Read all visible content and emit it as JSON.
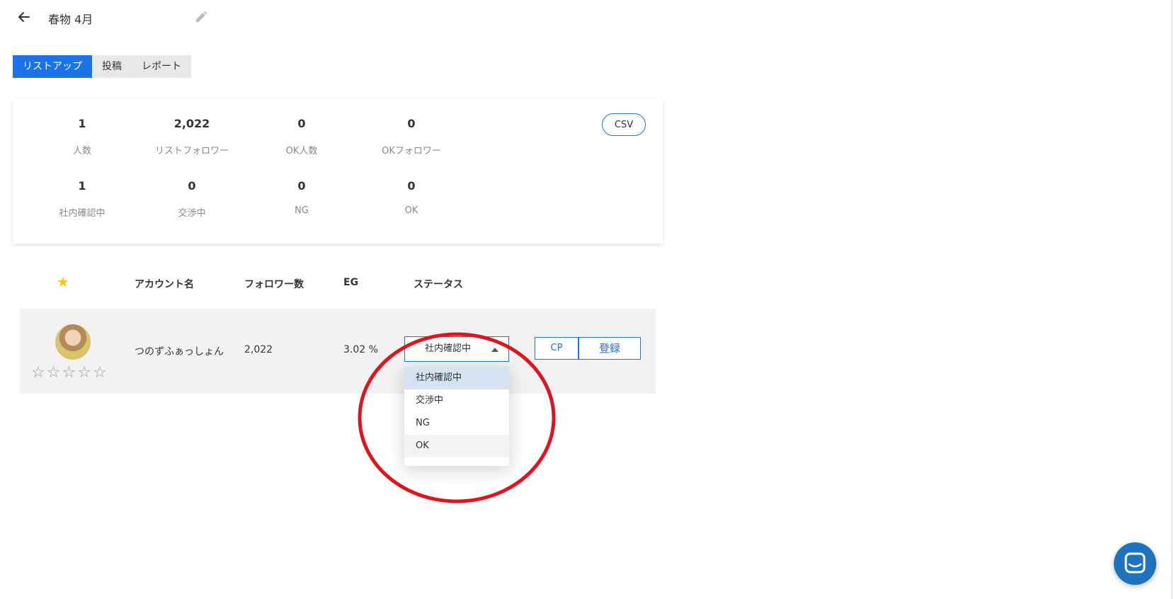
{
  "header": {
    "title": "春物 4月",
    "back_icon": "arrow-left-icon",
    "edit_icon": "pencil-icon"
  },
  "tabs": [
    {
      "label": "リストアップ",
      "active": true
    },
    {
      "label": "投稿",
      "active": false
    },
    {
      "label": "レポート",
      "active": false
    }
  ],
  "stats": {
    "csv_label": "CSV",
    "items": [
      {
        "value": "1",
        "label": "人数"
      },
      {
        "value": "2,022",
        "label": "リストフォロワー"
      },
      {
        "value": "0",
        "label": "OK人数"
      },
      {
        "value": "0",
        "label": "OKフォロワー"
      },
      {
        "value": "1",
        "label": "社内確認中"
      },
      {
        "value": "0",
        "label": "交渉中"
      },
      {
        "value": "0",
        "label": "NG"
      },
      {
        "value": "0",
        "label": "OK"
      }
    ]
  },
  "table": {
    "headers": {
      "star": "★",
      "account": "アカウント名",
      "followers": "フォロワー数",
      "eg": "EG",
      "status": "ステータス"
    },
    "rows": [
      {
        "account_name": "つのずふぁっしょん",
        "followers": "2,022",
        "eg": "3.02 %",
        "status": "社内確認中",
        "rating": 0,
        "cp_label": "CP",
        "register_label": "登録"
      }
    ]
  },
  "status_dropdown": {
    "options": [
      "社内確認中",
      "交渉中",
      "NG",
      "OK"
    ],
    "selected": "社内確認中",
    "hovered": "OK"
  },
  "colors": {
    "accent": "#1a73e8",
    "star": "#f5c518",
    "annotation": "#e0141e",
    "chat": "#1e73be"
  }
}
